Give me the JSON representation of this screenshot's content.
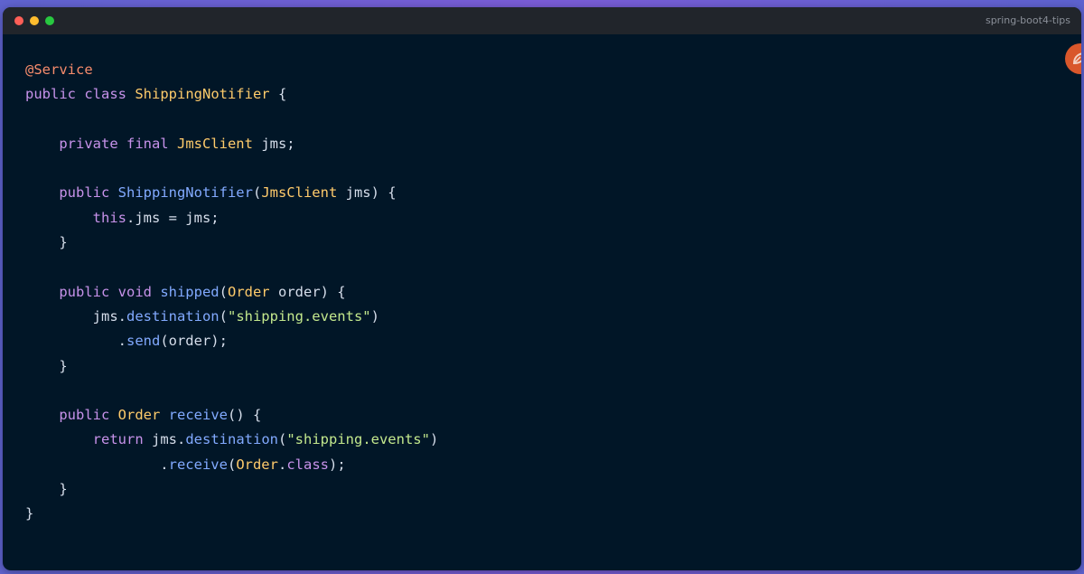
{
  "window": {
    "title": "spring-boot4-tips"
  },
  "colors": {
    "close": "#ff5f57",
    "minimize": "#febc2e",
    "maximize": "#28c840",
    "annotation": "#f78c6c",
    "keyword": "#c792ea",
    "type": "#ffcb6b",
    "function": "#82aaff",
    "string": "#c3e88d",
    "plain": "#d6deeb",
    "badge": "#d9572b"
  },
  "badge": {
    "icon": "spring-leaf-icon"
  },
  "code": {
    "lines": [
      [
        {
          "t": "@Service",
          "c": "annotation"
        }
      ],
      [
        {
          "t": "public class ",
          "c": "keyword"
        },
        {
          "t": "ShippingNotifier",
          "c": "type"
        },
        {
          "t": " {",
          "c": "plain"
        }
      ],
      [],
      [
        {
          "t": "    ",
          "c": "plain"
        },
        {
          "t": "private final ",
          "c": "keyword"
        },
        {
          "t": "JmsClient",
          "c": "type"
        },
        {
          "t": " jms;",
          "c": "plain"
        }
      ],
      [],
      [
        {
          "t": "    ",
          "c": "plain"
        },
        {
          "t": "public ",
          "c": "keyword"
        },
        {
          "t": "ShippingNotifier",
          "c": "function"
        },
        {
          "t": "(",
          "c": "plain"
        },
        {
          "t": "JmsClient",
          "c": "type"
        },
        {
          "t": " jms) {",
          "c": "plain"
        }
      ],
      [
        {
          "t": "        ",
          "c": "plain"
        },
        {
          "t": "this",
          "c": "keyword"
        },
        {
          "t": ".jms = jms;",
          "c": "plain"
        }
      ],
      [
        {
          "t": "    }",
          "c": "plain"
        }
      ],
      [],
      [
        {
          "t": "    ",
          "c": "plain"
        },
        {
          "t": "public void ",
          "c": "keyword"
        },
        {
          "t": "shipped",
          "c": "function"
        },
        {
          "t": "(",
          "c": "plain"
        },
        {
          "t": "Order",
          "c": "type"
        },
        {
          "t": " order) {",
          "c": "plain"
        }
      ],
      [
        {
          "t": "        jms.",
          "c": "plain"
        },
        {
          "t": "destination",
          "c": "function"
        },
        {
          "t": "(",
          "c": "plain"
        },
        {
          "t": "\"shipping.events\"",
          "c": "string"
        },
        {
          "t": ")",
          "c": "plain"
        }
      ],
      [
        {
          "t": "           .",
          "c": "plain"
        },
        {
          "t": "send",
          "c": "function"
        },
        {
          "t": "(order);",
          "c": "plain"
        }
      ],
      [
        {
          "t": "    }",
          "c": "plain"
        }
      ],
      [],
      [
        {
          "t": "    ",
          "c": "plain"
        },
        {
          "t": "public ",
          "c": "keyword"
        },
        {
          "t": "Order",
          "c": "type"
        },
        {
          "t": " ",
          "c": "plain"
        },
        {
          "t": "receive",
          "c": "function"
        },
        {
          "t": "() {",
          "c": "plain"
        }
      ],
      [
        {
          "t": "        ",
          "c": "plain"
        },
        {
          "t": "return",
          "c": "keyword"
        },
        {
          "t": " jms.",
          "c": "plain"
        },
        {
          "t": "destination",
          "c": "function"
        },
        {
          "t": "(",
          "c": "plain"
        },
        {
          "t": "\"shipping.events\"",
          "c": "string"
        },
        {
          "t": ")",
          "c": "plain"
        }
      ],
      [
        {
          "t": "                .",
          "c": "plain"
        },
        {
          "t": "receive",
          "c": "function"
        },
        {
          "t": "(",
          "c": "plain"
        },
        {
          "t": "Order",
          "c": "type"
        },
        {
          "t": ".",
          "c": "plain"
        },
        {
          "t": "class",
          "c": "keyword"
        },
        {
          "t": ");",
          "c": "plain"
        }
      ],
      [
        {
          "t": "    }",
          "c": "plain"
        }
      ],
      [
        {
          "t": "}",
          "c": "plain"
        }
      ]
    ]
  }
}
